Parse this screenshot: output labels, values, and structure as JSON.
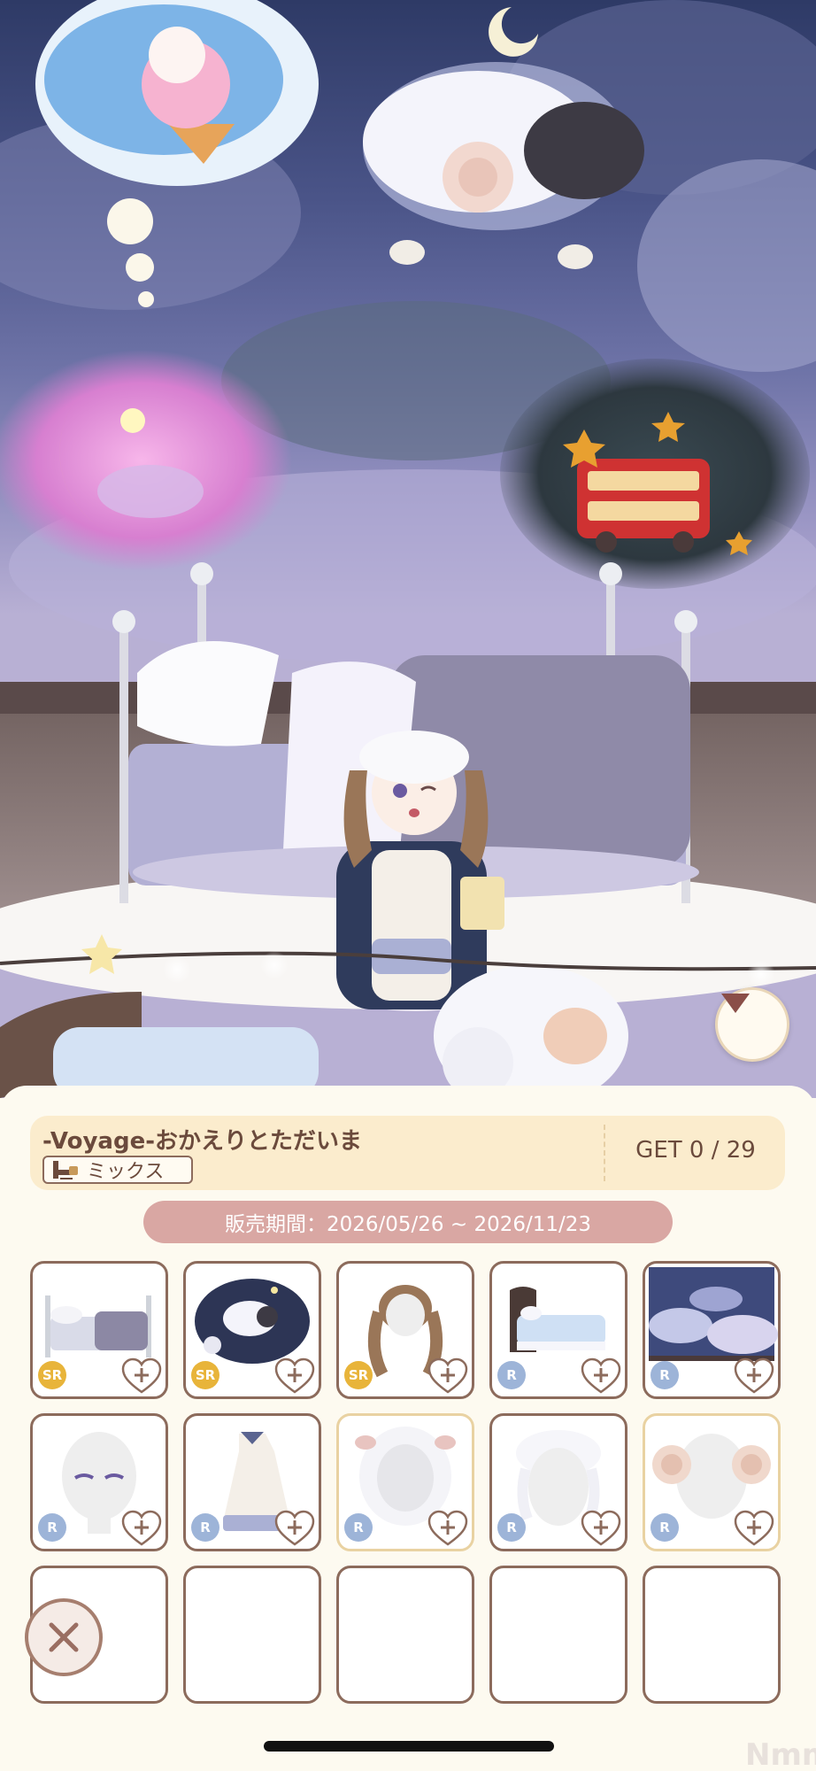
{
  "set": {
    "title": "-Voyage-おかえりとただいま",
    "type_label": "ミックス",
    "get_count": "GET 0 / 29"
  },
  "sale_period": "販売期間：2026/05/26 ~ 2026/11/23",
  "items": [
    {
      "name": "bed",
      "rarity": "SR",
      "frame": "brown",
      "icon": "bed-set-icon"
    },
    {
      "name": "dream-sheep-background",
      "rarity": "SR",
      "frame": "brown",
      "icon": "sheep-cloud-icon"
    },
    {
      "name": "twin-tail-hair",
      "rarity": "SR",
      "frame": "brown",
      "icon": "hair-icon"
    },
    {
      "name": "small-bed",
      "rarity": "R",
      "frame": "brown",
      "icon": "blue-bed-icon"
    },
    {
      "name": "night-sky-wallpaper",
      "rarity": "R",
      "frame": "brown",
      "icon": "cloud-wall-icon"
    },
    {
      "name": "sleepy-eyes",
      "rarity": "R",
      "frame": "brown",
      "icon": "face-icon"
    },
    {
      "name": "nightgown-dress",
      "rarity": "R",
      "frame": "brown",
      "icon": "dress-icon"
    },
    {
      "name": "sheep-hood",
      "rarity": "R",
      "frame": "gold",
      "icon": "hood-icon"
    },
    {
      "name": "fluffy-cap",
      "rarity": "R",
      "frame": "brown",
      "icon": "cap-icon"
    },
    {
      "name": "ram-horns",
      "rarity": "R",
      "frame": "gold",
      "icon": "horns-icon"
    }
  ],
  "watermark": "Nmm",
  "colors": {
    "panel_bg": "#fdfaf0",
    "set_box": "#fbeccd",
    "period_pill": "#d9a7a3",
    "frame_brown": "#8c6b5c",
    "frame_gold": "#e9d2a2",
    "rarity_sr": "#e8b43a",
    "rarity_r": "#9db4d8"
  }
}
